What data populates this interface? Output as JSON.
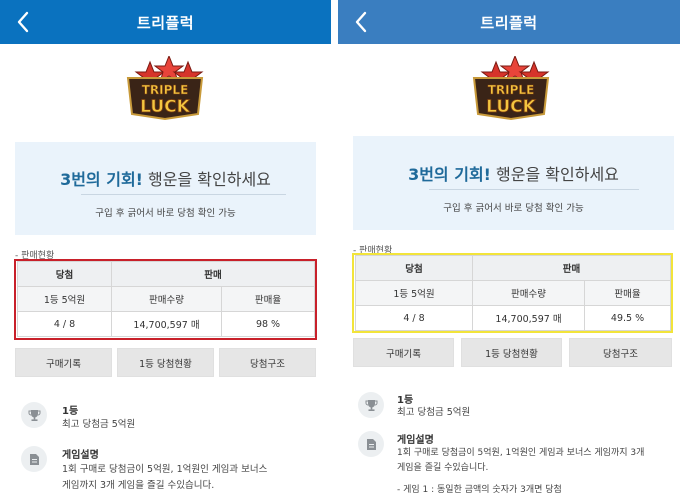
{
  "header": {
    "title": "트리플럭"
  },
  "logo": {
    "line1": "TRIPLE",
    "line2": "LUCK"
  },
  "promo": {
    "headline_strong": "3번의 기회!",
    "headline_rest": " 행운을 확인하세요",
    "subtext": "구입 후 긁어서 바로 당첨 확인 가능"
  },
  "sales_status_label": "- 판매현황",
  "table": {
    "col_win": "당첨",
    "col_sales": "판매",
    "row_prize": "1등 5억원",
    "col_qty": "판매수량",
    "col_rate": "판매율"
  },
  "panels": [
    {
      "win_count": "4 / 8",
      "qty": "14,700,597 매",
      "rate": "98 %",
      "highlight_color": "#c8202a",
      "header_color": "#0a72bf"
    },
    {
      "win_count": "4 / 8",
      "qty": "14,700,597 매",
      "rate": "49.5 %",
      "highlight_color": "#f2e43a",
      "header_color": "#3a7ec0"
    }
  ],
  "buttons": {
    "history": "구매기록",
    "first_status": "1등 당첨현황",
    "structure": "당첨구조"
  },
  "info": {
    "rank_title": "1등",
    "rank_text": "최고 당첨금 5억원",
    "desc_title": "게임설명",
    "desc_text_left_1": "1회 구매로 당첨금이 5억원, 1억원인 게임과 보너스",
    "desc_text_left_2": "게임까지 3개 게임을 즐길 수있습니다.",
    "desc_text_right_1": "1회 구매로 당첨금이 5억원, 1억원인 게임과 보너스 게임까지 3개",
    "desc_text_right_2": "게임을 즐길 수있습니다.",
    "desc_text_right_3": "- 게임 1 : 동일한 금액의 숫자가 3개면 당첨"
  },
  "icons": {
    "back": "chevron-left-icon",
    "trophy": "trophy-icon",
    "document": "document-icon"
  }
}
